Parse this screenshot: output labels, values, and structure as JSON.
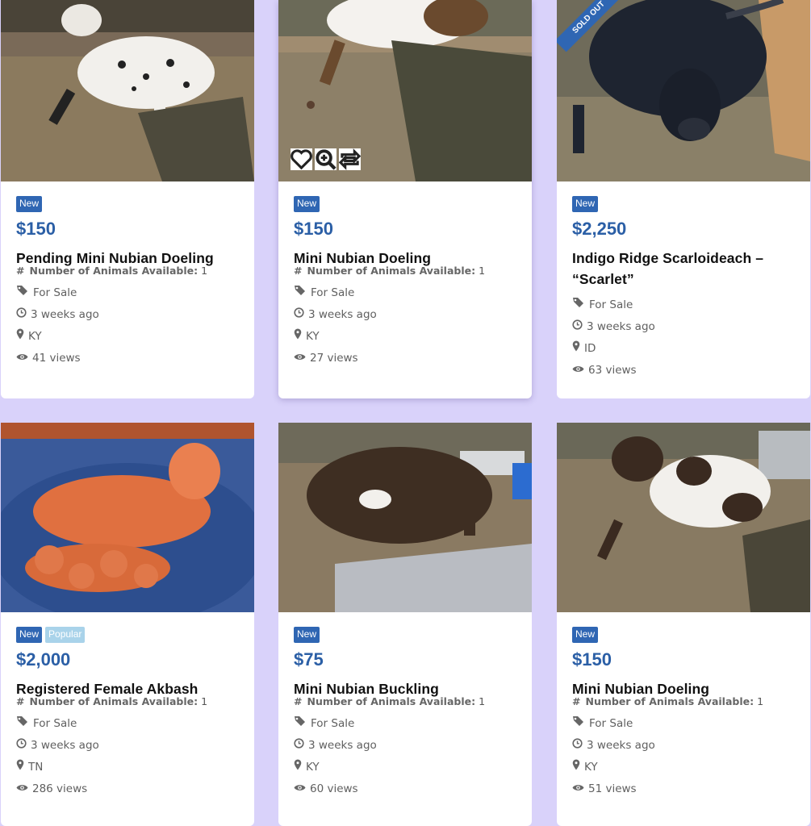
{
  "listings": [
    {
      "badges": [
        "New"
      ],
      "price": "$150",
      "title": "Pending Mini Nubian Doeling",
      "available_label": "Number of Animals Available:",
      "available_value": "1",
      "category": "For Sale",
      "posted": "3 weeks ago",
      "location": "KY",
      "views": "41 views"
    },
    {
      "badges": [
        "New"
      ],
      "price": "$150",
      "title": "Mini Nubian Doeling",
      "available_label": "Number of Animals Available:",
      "available_value": "1",
      "category": "For Sale",
      "posted": "3 weeks ago",
      "location": "KY",
      "views": "27 views"
    },
    {
      "badges": [
        "New"
      ],
      "ribbon": "SOLD OUT",
      "price": "$2,250",
      "title": "Indigo Ridge Scarloideach – “Scarlet”",
      "category": "For Sale",
      "posted": "3 weeks ago",
      "location": "ID",
      "views": "63 views"
    },
    {
      "badges": [
        "New",
        "Popular"
      ],
      "price": "$2,000",
      "title": "Registered Female Akbash",
      "available_label": "Number of Animals Available:",
      "available_value": "1",
      "category": "For Sale",
      "posted": "3 weeks ago",
      "location": "TN",
      "views": "286 views"
    },
    {
      "badges": [
        "New"
      ],
      "price": "$75",
      "title": "Mini Nubian Buckling",
      "available_label": "Number of Animals Available:",
      "available_value": "1",
      "category": "For Sale",
      "posted": "3 weeks ago",
      "location": "KY",
      "views": "60 views"
    },
    {
      "badges": [
        "New"
      ],
      "price": "$150",
      "title": "Mini Nubian Doeling",
      "available_label": "Number of Animals Available:",
      "available_value": "1",
      "category": "For Sale",
      "posted": "3 weeks ago",
      "location": "KY",
      "views": "51 views"
    }
  ],
  "icons": {
    "hash": "hash-icon",
    "category": "tag-icon",
    "posted": "clock-icon",
    "location": "map-marker-icon",
    "views": "eye-icon",
    "favorite": "heart-icon",
    "zoom": "zoom-icon",
    "compare": "compare-icon"
  },
  "colors": {
    "page_background": "#d9d2fa",
    "price": "#2b5fa6",
    "badge_new": "#2f66b3",
    "badge_popular": "#a9d3ea"
  }
}
